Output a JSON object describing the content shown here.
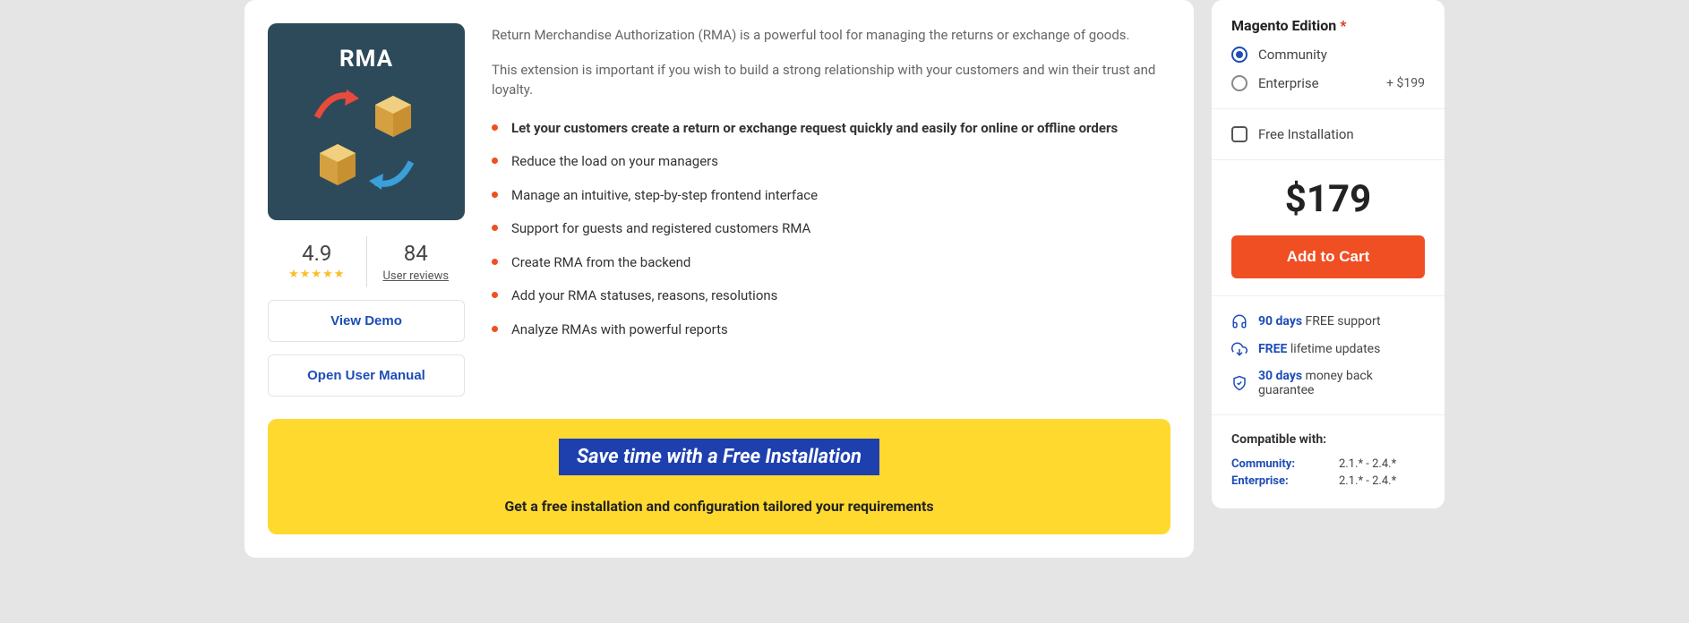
{
  "product": {
    "image_title": "RMA",
    "rating": "4.9",
    "review_count": "84",
    "review_label": "User reviews",
    "view_demo": "View Demo",
    "open_manual": "Open User Manual",
    "desc1": "Return Merchandise Authorization (RMA) is a powerful tool for managing the returns or exchange of goods.",
    "desc2": "This extension is important if you wish to build a strong relationship with your customers and win their trust and loyalty.",
    "features": [
      "Let your customers create a return or exchange request quickly and easily for online or offline orders",
      "Reduce the load on your managers",
      "Manage an intuitive, step-by-step frontend interface",
      "Support for guests and registered customers RMA",
      "Create RMA from the backend",
      "Add your RMA statuses, reasons, resolutions",
      "Analyze RMAs with powerful reports"
    ]
  },
  "promo": {
    "title": "Save time with a Free Installation",
    "subtitle": "Get a free installation and configuration tailored your requirements"
  },
  "sidebar": {
    "edition_title": "Magento Edition",
    "community": "Community",
    "enterprise": "Enterprise",
    "enterprise_price": "+ $199",
    "free_install": "Free Installation",
    "price": "$179",
    "add_to_cart": "Add to Cart",
    "benefits": {
      "support_days": "90 days",
      "support_text": " FREE support",
      "updates_bold": "FREE",
      "updates_text": " lifetime updates",
      "guarantee_days": "30 days",
      "guarantee_text": " money back guarantee"
    },
    "compat": {
      "title": "Compatible with:",
      "community_label": "Community:",
      "community_value": "2.1.* - 2.4.*",
      "enterprise_label": "Enterprise:",
      "enterprise_value": "2.1.* - 2.4.*"
    }
  }
}
